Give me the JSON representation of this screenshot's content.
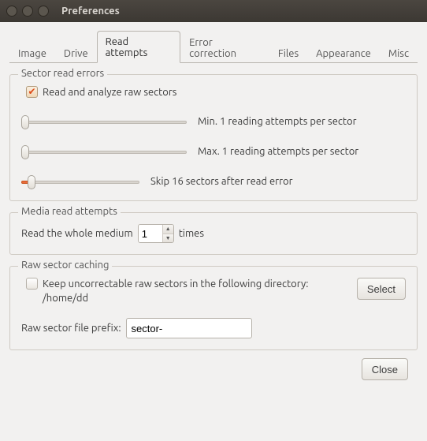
{
  "window": {
    "title": "Preferences"
  },
  "tabs": [
    {
      "label": "Image"
    },
    {
      "label": "Drive"
    },
    {
      "label": "Read attempts"
    },
    {
      "label": "Error correction"
    },
    {
      "label": "Files"
    },
    {
      "label": "Appearance"
    },
    {
      "label": "Misc"
    }
  ],
  "group1": {
    "title": "Sector read errors",
    "check_label": "Read and analyze raw sectors",
    "slider1_label": "Min. 1 reading attempts per sector",
    "slider2_label": "Max. 1 reading attempts per sector",
    "slider3_label": "Skip 16 sectors after read error"
  },
  "group2": {
    "title": "Media read attempts",
    "label_left": "Read the whole medium",
    "value": "1",
    "label_right": "times"
  },
  "group3": {
    "title": "Raw sector caching",
    "keep_line": "Keep uncorrectable raw sectors in the following directory:",
    "dir": "/home/dd",
    "select_btn": "Select",
    "prefix_label": "Raw sector file prefix:",
    "prefix_value": "sector-"
  },
  "footer": {
    "close": "Close"
  }
}
